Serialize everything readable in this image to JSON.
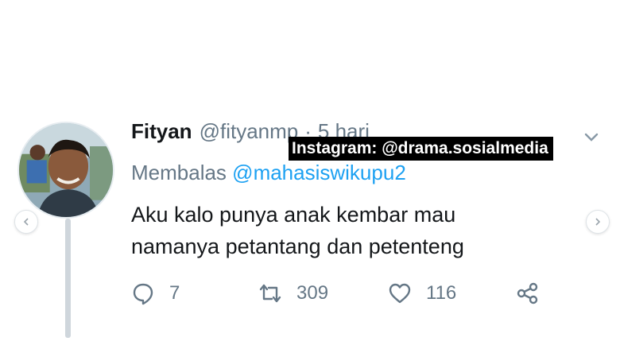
{
  "tweet": {
    "author_name": "Fityan",
    "author_handle": "@fityanmp",
    "separator": "·",
    "time": "5 hari",
    "replying_prefix": "Membalas",
    "replying_to": "@mahasiswikupu2",
    "text_lines": [
      "Aku kalo punya anak kembar mau",
      "namanya petantang dan petenteng"
    ]
  },
  "actions": {
    "reply_icon": "speech-bubble-icon",
    "reply_count": "7",
    "retweet_icon": "retweet-icon",
    "retweet_count": "309",
    "like_icon": "heart-icon",
    "like_count": "116",
    "share_icon": "share-icon"
  },
  "watermark": {
    "text": "Instagram: @drama.sosialmedia"
  },
  "colors": {
    "text_primary": "#14171a",
    "text_secondary": "#657786",
    "mention": "#1da1f2",
    "thread_line": "#cfd6dc",
    "watermark_bg": "#000000"
  }
}
